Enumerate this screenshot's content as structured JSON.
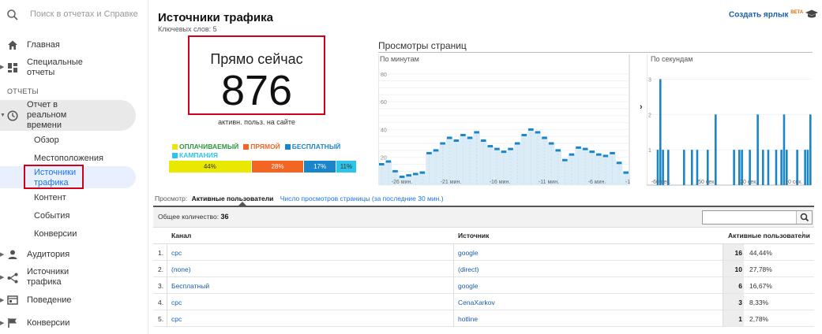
{
  "search": {
    "placeholder": "Поиск в отчетах и Справке"
  },
  "sidebar": {
    "home": "Главная",
    "custom_reports": "Специальные отчеты",
    "section": "ОТЧЕТЫ",
    "realtime": "Отчет в реальном времени",
    "realtime_items": [
      "Обзор",
      "Местоположения",
      "Источники трафика",
      "Контент",
      "События",
      "Конверсии"
    ],
    "audience": "Аудитория",
    "acquisition": "Источники трафика",
    "behavior": "Поведение",
    "conversions": "Конверсии"
  },
  "header": {
    "title": "Источники трафика",
    "subtitle": "Ключевых слов: 5",
    "shortcut": "Создать ярлык",
    "beta": "BETA"
  },
  "now": {
    "label": "Прямо сейчас",
    "value": "876",
    "caption": "активн. польз. на сайте"
  },
  "breakdown": {
    "legend": [
      {
        "name": "ОПЛАЧИВАЕМЫЙ",
        "color": "#e8e800"
      },
      {
        "name": "ПРЯМОЙ",
        "color": "#f26522"
      },
      {
        "name": "БЕСПЛАТНЫЙ",
        "color": "#1a85c8"
      },
      {
        "name": "КАМПАНИЯ",
        "color": "#2ec4e8"
      }
    ],
    "segments": [
      {
        "label": "44%",
        "share": 44,
        "color": "#e8e800",
        "text": "#333"
      },
      {
        "label": "28%",
        "share": 28,
        "color": "#f26522",
        "text": "#fff"
      },
      {
        "label": "17%",
        "share": 17,
        "color": "#1a85c8",
        "text": "#fff"
      },
      {
        "label": "11%",
        "share": 11,
        "color": "#2ec4e8",
        "text": "#333"
      }
    ]
  },
  "pageviews": {
    "title": "Просмотры страниц",
    "per_minute_label": "По минутам",
    "per_second_label": "По секундам",
    "expand_arrow": "›"
  },
  "chart_data": [
    {
      "type": "area",
      "title": "По минутам",
      "ylim": [
        0,
        85
      ],
      "yticks": [
        "80",
        "60",
        "40",
        "20"
      ],
      "xticks": [
        "-26 мин.",
        "-21 мин.",
        "-16 мин.",
        "-11 мин.",
        "-6 мин.",
        "-1"
      ],
      "values": [
        15,
        17,
        10,
        6,
        7,
        8,
        9,
        23,
        25,
        30,
        34,
        32,
        36,
        34,
        38,
        32,
        28,
        26,
        24,
        26,
        30,
        36,
        40,
        38,
        34,
        30,
        25,
        18,
        22,
        27,
        26,
        24,
        22,
        21,
        23,
        16,
        9
      ]
    },
    {
      "type": "bar",
      "title": "По секундам",
      "ylim": [
        0,
        3.3
      ],
      "yticks": [
        "3",
        "2",
        "1"
      ],
      "xticks": [
        "-60 сек.",
        "-50 сек.",
        "-30 сек.",
        "-10 сек."
      ],
      "x": [
        2,
        3,
        4,
        6,
        12,
        15,
        17,
        21,
        24,
        31,
        33,
        34,
        37,
        40,
        42,
        44,
        47,
        49,
        50,
        51,
        55,
        58,
        59,
        60
      ],
      "values": [
        1,
        3,
        1,
        1,
        1,
        1,
        1,
        1,
        2,
        1,
        1,
        1,
        1,
        2,
        1,
        1,
        1,
        1,
        2,
        1,
        1,
        1,
        1,
        2
      ]
    }
  ],
  "tabs": {
    "prefix": "Просмотр:",
    "active": "Активные пользователи",
    "inactive": "Число просмотров страницы (за последние 30 мин.)"
  },
  "table": {
    "total_label": "Общее количество:",
    "total_value": "36",
    "headers": {
      "channel": "Канал",
      "source": "Источник",
      "users": "Активные пользователи"
    },
    "rows": [
      {
        "num": "1.",
        "channel": "cpc",
        "source": "google",
        "count": "16",
        "pct": "44,44%"
      },
      {
        "num": "2.",
        "channel": "(none)",
        "source": "(direct)",
        "count": "10",
        "pct": "27,78%"
      },
      {
        "num": "3.",
        "channel": "Бесплатный",
        "source": "google",
        "count": "6",
        "pct": "16,67%"
      },
      {
        "num": "4.",
        "channel": "cpc",
        "source": "CenaXarkov",
        "count": "3",
        "pct": "8,33%"
      },
      {
        "num": "5.",
        "channel": "cpc",
        "source": "hotline",
        "count": "1",
        "pct": "2,78%"
      }
    ]
  }
}
